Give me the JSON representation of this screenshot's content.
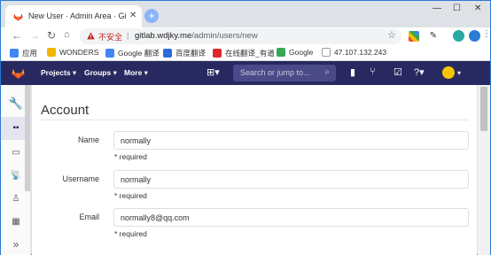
{
  "browser": {
    "tab_title": "New User · Admin Area · GitL",
    "url_security": "不安全",
    "url_host": "gitlab.wdjky.me",
    "url_path": "/admin/users/new",
    "bookmarks": [
      {
        "label": "应用",
        "icon": "apps-icon",
        "color": "#4285f4"
      },
      {
        "label": "WONDERS",
        "icon": "folder-icon",
        "color": "#f2b600"
      },
      {
        "label": "Google 翻译",
        "icon": "google-translate-icon",
        "color": "#4285f4"
      },
      {
        "label": "百度翻译",
        "icon": "baidu-translate-icon",
        "color": "#2f6bd8"
      },
      {
        "label": "在线翻译_有道",
        "icon": "youdao-icon",
        "color": "#e0262e"
      },
      {
        "label": "Google",
        "icon": "google-icon",
        "color": "#34a853"
      },
      {
        "label": "47.107.132.243",
        "icon": "page-icon",
        "color": "#9aa0a6"
      }
    ]
  },
  "gitlab_nav": {
    "projects": "Projects ▾",
    "groups": "Groups ▾",
    "more": "More ▾",
    "search_placeholder": "Search or jump to..."
  },
  "page": {
    "section_title": "Account",
    "fields": [
      {
        "label": "Name",
        "value": "normally",
        "hint": "* required"
      },
      {
        "label": "Username",
        "value": "normally",
        "hint": "* required"
      },
      {
        "label": "Email",
        "value": "normally8@qq.com",
        "hint": "* required"
      }
    ]
  }
}
